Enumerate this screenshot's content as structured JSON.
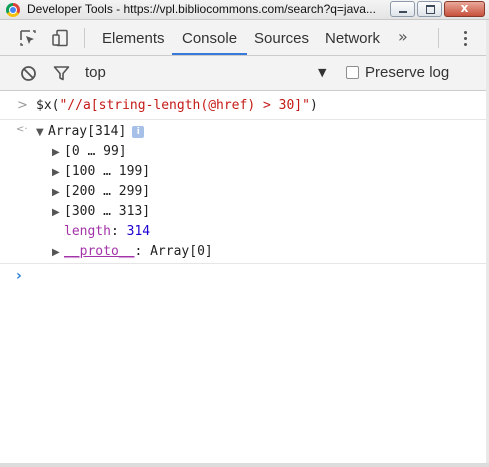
{
  "window": {
    "title": "Developer Tools - https://vpl.bibliocommons.com/search?q=java...",
    "close_glyph": "x"
  },
  "devtools": {
    "tabs": [
      {
        "label": "Elements",
        "active": false
      },
      {
        "label": "Console",
        "active": true
      },
      {
        "label": "Sources",
        "active": false
      },
      {
        "label": "Network",
        "active": false
      }
    ],
    "more_glyph": "»"
  },
  "console_toolbar": {
    "context": "top",
    "dropdown_glyph": "▼",
    "preserve_log_label": "Preserve log",
    "preserve_log_checked": false
  },
  "console": {
    "input_glyph": ">",
    "output_glyph": "<·",
    "command_prefix": "$x(",
    "command_string": "\"//a[string-length(@href) > 30]\"",
    "command_suffix": ")",
    "result_label": "Array[314]",
    "info_badge": "i",
    "groups": [
      "[0 … 99]",
      "[100 … 199]",
      "[200 … 299]",
      "[300 … 313]"
    ],
    "length_key": "length",
    "length_sep": ": ",
    "length_value": "314",
    "proto_key": "__proto__",
    "proto_sep": ": ",
    "proto_value": "Array[0]",
    "prompt_glyph": "›"
  },
  "colors": {
    "accent": "#3879d9",
    "string": "#c41a16",
    "property": "#a333a8",
    "number": "#1c00cf"
  }
}
